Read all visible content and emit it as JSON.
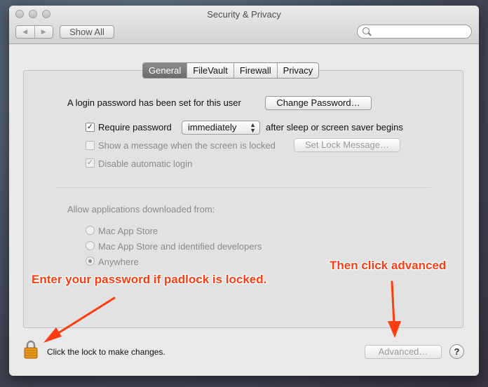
{
  "window": {
    "title": "Security & Privacy"
  },
  "toolbar": {
    "back": "◀",
    "forward": "▶",
    "show_all": "Show All",
    "search_placeholder": ""
  },
  "tabs": [
    {
      "label": "General",
      "active": true
    },
    {
      "label": "FileVault",
      "active": false
    },
    {
      "label": "Firewall",
      "active": false
    },
    {
      "label": "Privacy",
      "active": false
    }
  ],
  "general": {
    "login_text": "A login password has been set for this user",
    "change_password": "Change Password…",
    "require_password": {
      "checked": true,
      "label": "Require password",
      "value": "immediately",
      "suffix": "after sleep or screen saver begins"
    },
    "show_message": {
      "checked": false,
      "label": "Show a message when the screen is locked",
      "button": "Set Lock Message…"
    },
    "disable_login": {
      "checked": true,
      "label": "Disable automatic login"
    },
    "allow_label": "Allow applications downloaded from:",
    "radios": [
      {
        "label": "Mac App Store",
        "selected": false
      },
      {
        "label": "Mac App Store and identified developers",
        "selected": false
      },
      {
        "label": "Anywhere",
        "selected": true
      }
    ]
  },
  "footer": {
    "lock_text": "Click the lock to make changes.",
    "advanced": "Advanced…",
    "help": "?"
  },
  "annotations": {
    "padlock": "Enter your password if padlock is locked.",
    "advanced": "Then click advanced",
    "color": "#ff3d12"
  },
  "icons": {
    "lock": "padlock-icon",
    "search": "magnifier-icon"
  }
}
